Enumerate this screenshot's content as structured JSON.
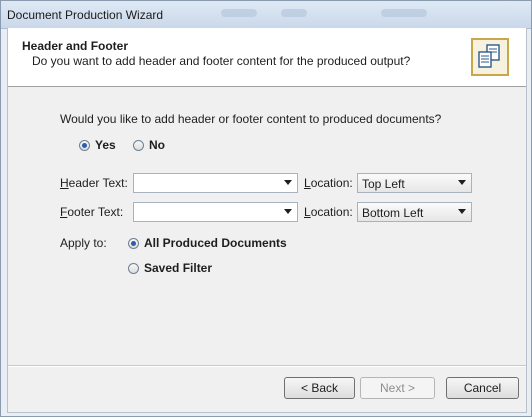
{
  "window": {
    "title": "Document Production Wizard"
  },
  "header": {
    "title": "Header and Footer",
    "subtitle": "Do you want to add header and footer content for the produced output?",
    "icon": "documents-icon"
  },
  "question": "Would you like to add header or footer content to produced documents?",
  "yes_no": {
    "yes_label": "Yes",
    "no_label": "No",
    "selected": "Yes"
  },
  "header_text": {
    "label_accel": "H",
    "label_rest": "eader Text:",
    "value": ""
  },
  "footer_text": {
    "label_accel": "F",
    "label_rest": "ooter Text:",
    "value": ""
  },
  "header_location": {
    "label_accel": "L",
    "label_rest": "ocation:",
    "value": "Top Left"
  },
  "footer_location": {
    "label_accel": "L",
    "label_rest": "ocation:",
    "value": "Bottom Left"
  },
  "apply_to": {
    "label": "Apply to:",
    "option_all": "All Produced Documents",
    "option_saved": "Saved Filter",
    "selected": "All Produced Documents"
  },
  "buttons": {
    "back": "< Back",
    "next": "Next >",
    "cancel": "Cancel"
  }
}
